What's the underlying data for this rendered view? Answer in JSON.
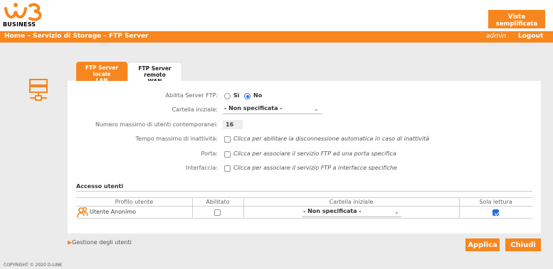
{
  "brand": {
    "logo_text": "BUSINESS",
    "accent": "#f7861e"
  },
  "header": {
    "vista_line1": "Vista",
    "vista_line2": "semplificata",
    "breadcrumb": "Home – Servizio di Storage – FTP Server",
    "user": "admin",
    "logout": "Logout"
  },
  "tabs": [
    {
      "line1": "FTP Server locale",
      "line2": "LAN",
      "active": true
    },
    {
      "line1": "FTP Server remoto",
      "line2": "WAN",
      "active": false
    }
  ],
  "form": {
    "abilita_label": "Abilita Server FTP:",
    "si": "Sì",
    "no": "No",
    "abilita_value": "No",
    "cartella_label": "Cartella iniziale:",
    "cartella_value": "- Non specificata -",
    "max_utenti_label": "Numero massimo di utenti contemporanei:",
    "max_utenti_value": "16",
    "tempo_label": "Tempo massimo di inattività:",
    "tempo_text": "Clicca per abilitare la disconnessione automatica in caso di inattività",
    "porta_label": "Porta:",
    "porta_text": "Clicca per associare il servizio FTP ad una porta specifica",
    "interfaccia_label": "Interfaccia:",
    "interfaccia_text": "Clicca per associare il servizio FTP a interfacce specifiche"
  },
  "users": {
    "title": "Accesso utenti",
    "columns": [
      "Profilo utente",
      "Abilitato",
      "Cartella iniziale",
      "Sola lettura"
    ],
    "rows": [
      {
        "profile": "Utente Anonimo",
        "enabled": false,
        "folder": "- Non specificata -",
        "readonly": true
      }
    ]
  },
  "footer": {
    "gestione": "Gestione degli utenti",
    "applica": "Applica",
    "chiudi": "Chiudi",
    "copyright": "COPYRIGHT © 2020 D-LINK"
  }
}
